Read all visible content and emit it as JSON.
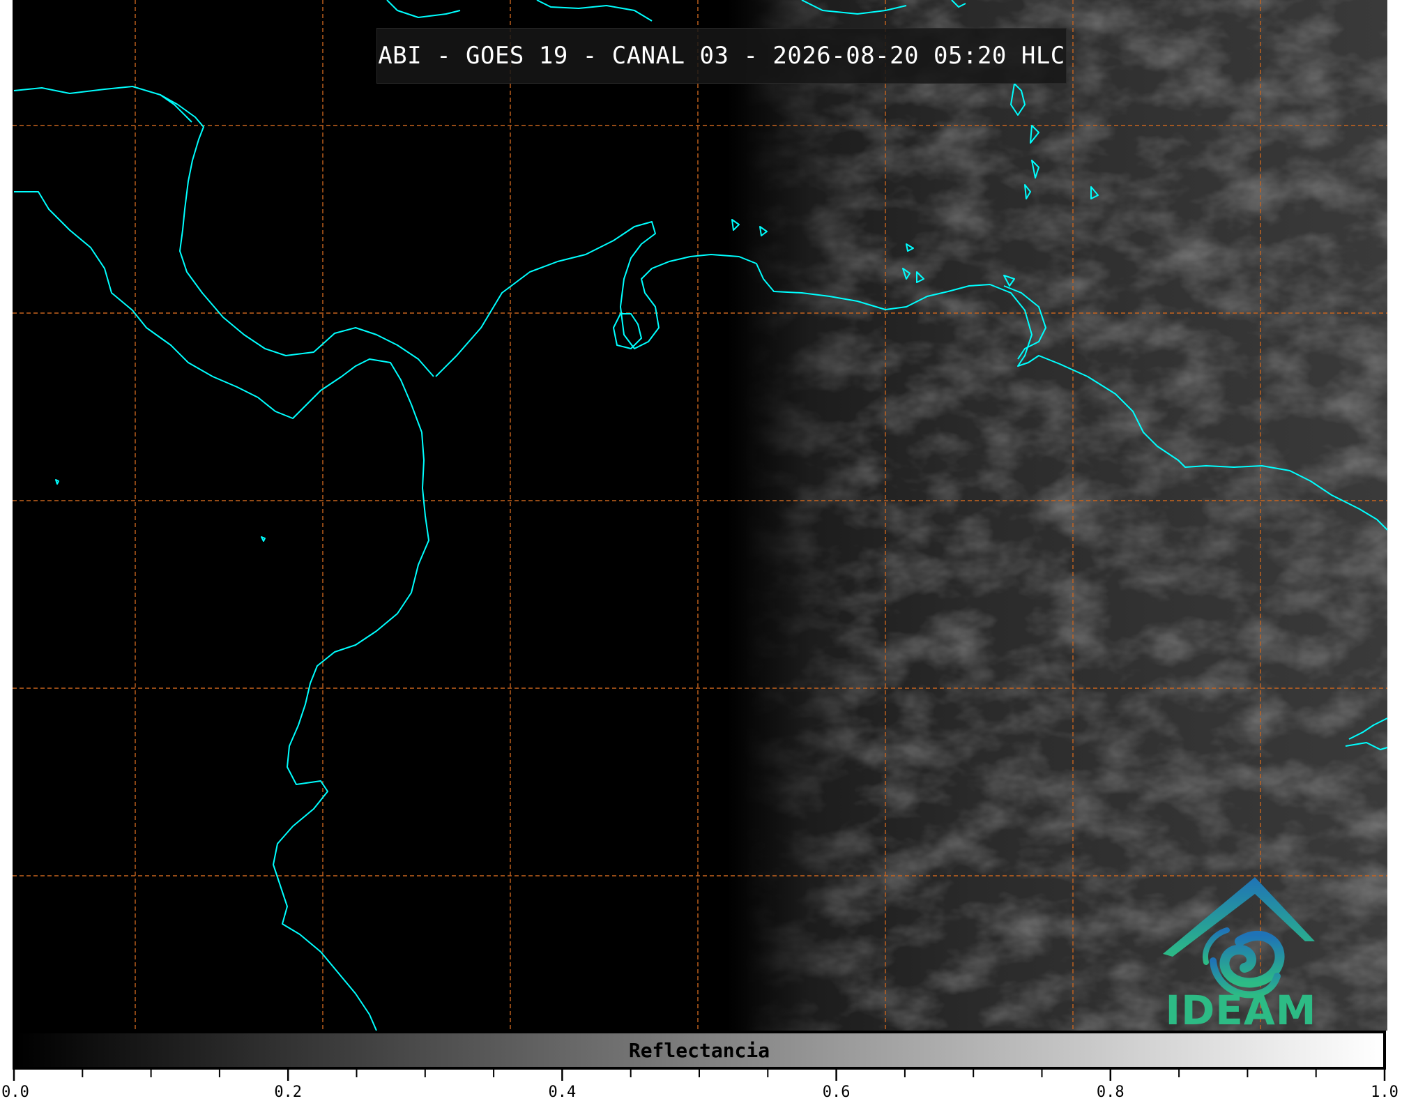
{
  "title": "ABI - GOES 19 - CANAL 03 - 2026-08-20 05:20 HLC",
  "colorbar": {
    "label": "Reflectancia",
    "min": 0.0,
    "max": 1.0,
    "major_ticks": [
      "0.0",
      "0.2",
      "0.4",
      "0.6",
      "0.8",
      "1.0"
    ],
    "minor_tick_step": 0.05
  },
  "logo": {
    "text": "IDEAM",
    "icon": "ideam-mountain-swirl-logo"
  },
  "colors": {
    "coastline": "#00ffff",
    "gridline": "#c8641e",
    "logo_blue": "#1f73b7",
    "logo_green": "#2dbb85"
  },
  "grid": {
    "style": "dashed",
    "visible": true
  }
}
